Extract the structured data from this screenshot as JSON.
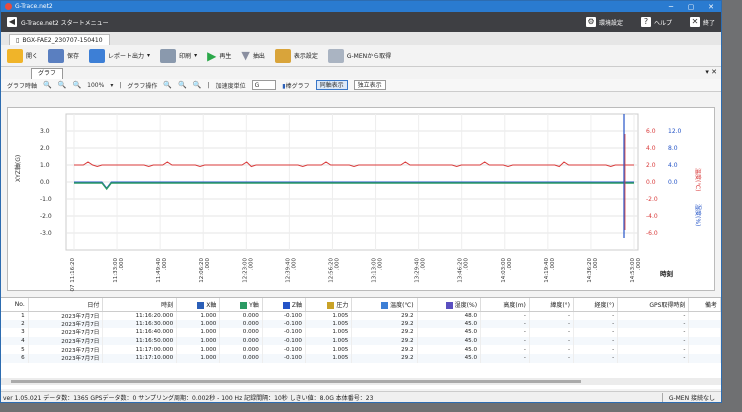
{
  "window": {
    "title": "G-Trace.net2"
  },
  "menu": {
    "title": "G-Trace.net2 スタートメニュー",
    "env": "環境設定",
    "help": "ヘルプ",
    "exit": "終了"
  },
  "file_tab": "BGX-FAE2_230707-150410",
  "toolbar": [
    "開く",
    "保存",
    "レポート出力",
    "印刷",
    "再生",
    "抽出",
    "表示設定",
    "G-MENから取得"
  ],
  "chart_tab": "グラフ",
  "chart_opts": {
    "time_axis": "グラフ時軸",
    "zoom": "100%",
    "graph_ops": "グラフ操作",
    "accel_unit": "加速度単位",
    "accel_unit_value": "G",
    "bar_graph": "棒グラフ",
    "sync": "同軸表示",
    "indep": "独立表示"
  },
  "chart_data": {
    "type": "line",
    "ylabel": "XYZ軸(G)",
    "ylabel_r1": "温度(℃)",
    "ylabel_r2": "湿度(%)",
    "xlabel": "時刻",
    "y_ticks": [
      "3.0",
      "2.0",
      "1.0",
      "0.0",
      "-1.0",
      "-2.0",
      "-3.0"
    ],
    "r1_ticks": [
      "6.0",
      "4.0",
      "2.0",
      "0.0",
      "-2.0",
      "-4.0",
      "-6.0"
    ],
    "r2_ticks": [
      "12.0",
      "8.0",
      "4.0",
      "0.0"
    ],
    "x_ticks": [
      "23-07-07 11:16:20",
      "11:33:00",
      "11:49:40",
      "12:06:20",
      "12:23:00",
      "12:39:40",
      "12:56:20",
      "13:13:00",
      "13:29:40",
      "13:46:20",
      "14:03:00",
      "14:19:40",
      "14:36:20",
      "14:53:00"
    ],
    "x_ticks_sub": [
      "",
      ".000",
      ".000",
      ".000",
      ".000",
      ".000",
      ".000",
      ".000",
      ".000",
      ".000",
      ".000",
      ".000",
      ".000",
      ".000"
    ],
    "series": [
      {
        "name": "温度(℃)",
        "color": "#d93a3a",
        "level": 1.0
      },
      {
        "name": "Z軸",
        "color": "#2454c7",
        "level": 0.0
      },
      {
        "name": "Y軸",
        "color": "#2a9a63",
        "level": 0.0
      }
    ]
  },
  "grid": {
    "headers": [
      "No.",
      "日付",
      "時刻",
      "X軸",
      "Y軸",
      "Z軸",
      "圧力",
      "温度(℃)",
      "湿度(%)",
      "高度(m)",
      "緯度(°)",
      "経度(°)",
      "GPS取得時刻",
      "備考"
    ],
    "rows": [
      [
        "1",
        "2023年7月7日",
        "11:16:20.000",
        "1.000",
        "0.000",
        "-0.100",
        "1.005",
        "29.2",
        "48.0",
        "-",
        "-",
        "-",
        "-",
        ""
      ],
      [
        "2",
        "2023年7月7日",
        "11:16:30.000",
        "1.000",
        "0.000",
        "-0.100",
        "1.005",
        "29.2",
        "45.0",
        "-",
        "-",
        "-",
        "-",
        ""
      ],
      [
        "3",
        "2023年7月7日",
        "11:16:40.000",
        "1.000",
        "0.000",
        "-0.100",
        "1.005",
        "29.2",
        "45.0",
        "-",
        "-",
        "-",
        "-",
        ""
      ],
      [
        "4",
        "2023年7月7日",
        "11:16:50.000",
        "1.000",
        "0.000",
        "-0.100",
        "1.005",
        "29.2",
        "45.0",
        "-",
        "-",
        "-",
        "-",
        ""
      ],
      [
        "5",
        "2023年7月7日",
        "11:17:00.000",
        "1.000",
        "0.000",
        "-0.100",
        "1.005",
        "29.2",
        "45.0",
        "-",
        "-",
        "-",
        "-",
        ""
      ],
      [
        "6",
        "2023年7月7日",
        "11:17:10.000",
        "1.000",
        "0.000",
        "-0.100",
        "1.005",
        "29.2",
        "45.0",
        "-",
        "-",
        "-",
        "-",
        ""
      ]
    ]
  },
  "status": {
    "text": "ver 1.05.021  データ数：1365  GPSデータ数：0  サンプリング周期：0.002秒 - 100 Hz  記録間隔：10秒  しきい値：8.0G  本体番号：23",
    "right": "G-MEN 接続なし"
  }
}
